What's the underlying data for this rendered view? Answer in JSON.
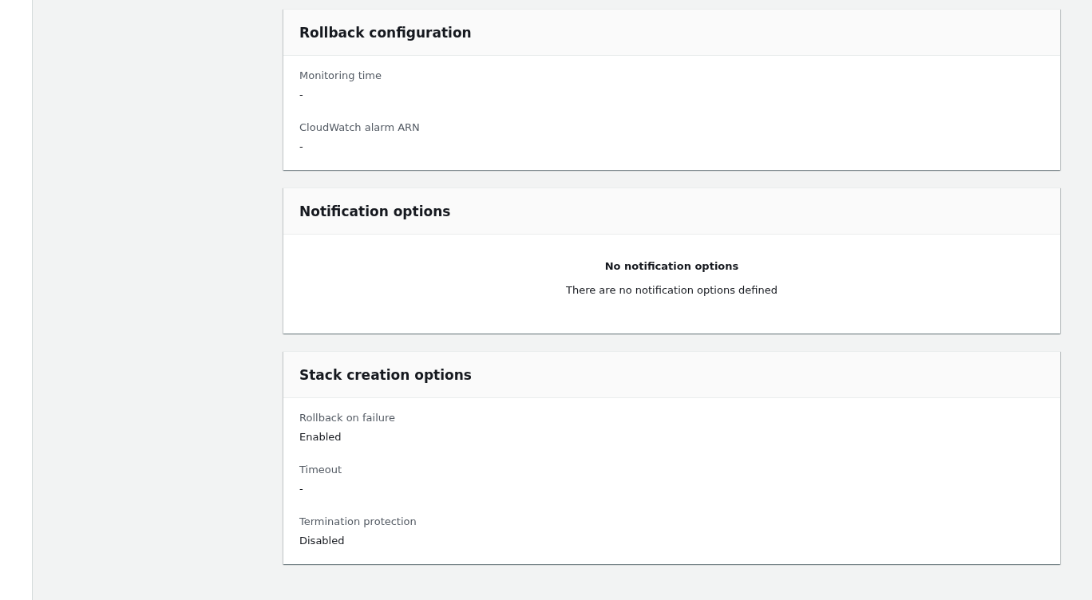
{
  "sections": [
    {
      "kind": "fields",
      "title": "Rollback configuration",
      "fields": [
        {
          "label": "Monitoring time",
          "value": "-"
        },
        {
          "label": "CloudWatch alarm ARN",
          "value": "-"
        }
      ]
    },
    {
      "kind": "empty",
      "title": "Notification options",
      "empty_title": "No notification options",
      "empty_text": "There are no notification options defined"
    },
    {
      "kind": "fields",
      "title": "Stack creation options",
      "fields": [
        {
          "label": "Rollback on failure",
          "value": "Enabled"
        },
        {
          "label": "Timeout",
          "value": "-"
        },
        {
          "label": "Termination protection",
          "value": "Disabled"
        }
      ]
    }
  ]
}
